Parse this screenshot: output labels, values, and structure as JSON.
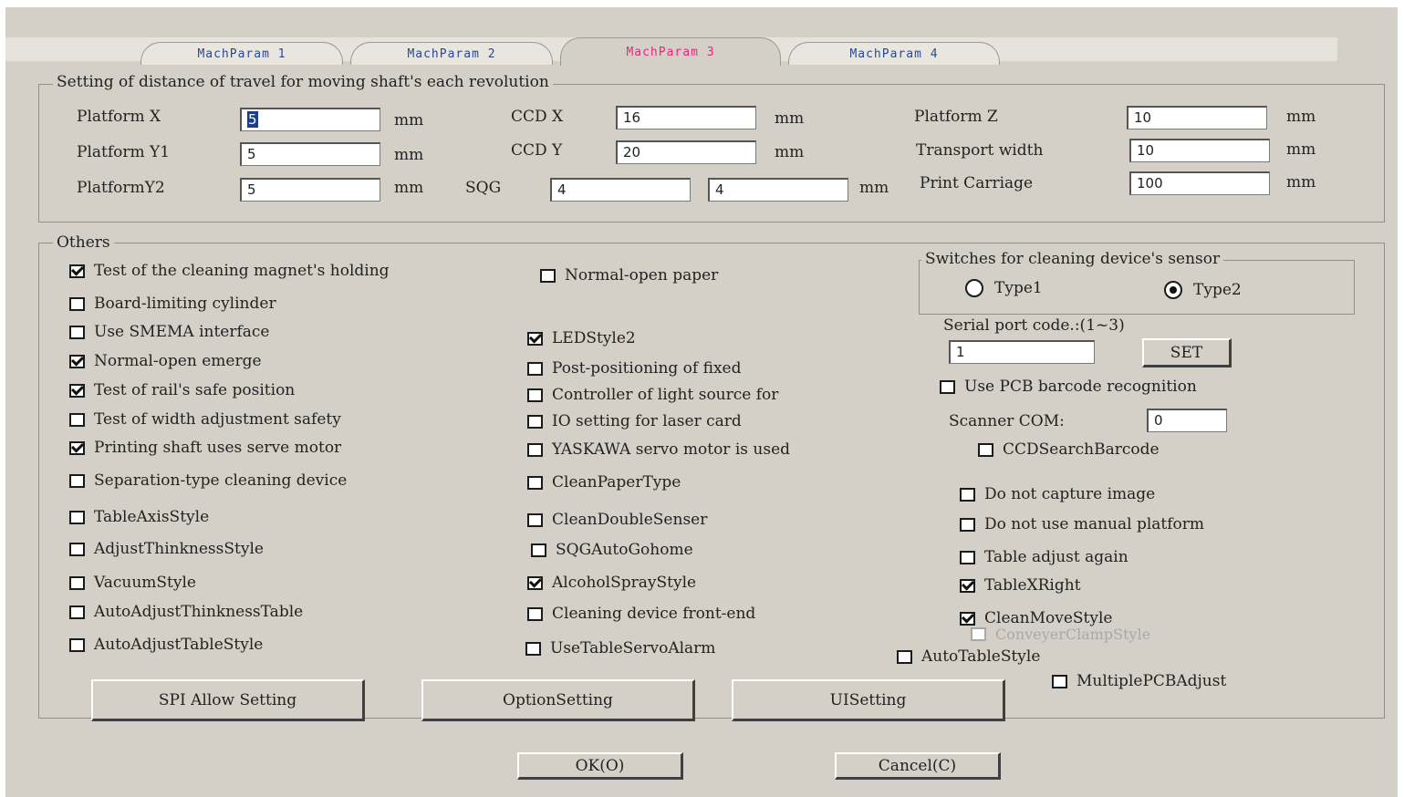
{
  "tabs": [
    "MachParam 1",
    "MachParam 2",
    "MachParam 3",
    "MachParam 4"
  ],
  "active_tab": 2,
  "travel": {
    "legend": "Setting of distance of travel for moving shaft's each revolution",
    "unit": "mm",
    "platform_x": {
      "label": "Platform X",
      "value": "5"
    },
    "platform_y1": {
      "label": "Platform Y1",
      "value": "5"
    },
    "platform_y2": {
      "label": "PlatformY2",
      "value": "5"
    },
    "ccd_x": {
      "label": "CCD X",
      "value": "16"
    },
    "ccd_y": {
      "label": "CCD Y",
      "value": "20"
    },
    "sqg": {
      "label": "SQG",
      "value1": "4",
      "value2": "4"
    },
    "platform_z": {
      "label": "Platform Z",
      "value": "10"
    },
    "transport_width": {
      "label": "Transport width",
      "value": "10"
    },
    "print_carriage": {
      "label": "Print Carriage",
      "value": "100"
    }
  },
  "others": {
    "legend": "Others",
    "col1": [
      {
        "label": "Test of the cleaning magnet's holding",
        "checked": true
      },
      {
        "label": "Board-limiting cylinder",
        "checked": false
      },
      {
        "label": "Use SMEMA interface",
        "checked": false
      },
      {
        "label": "Normal-open emerge",
        "checked": true
      },
      {
        "label": "Test of rail's safe position",
        "checked": true
      },
      {
        "label": "Test of width adjustment safety",
        "checked": false
      },
      {
        "label": "Printing shaft uses serve motor",
        "checked": true
      },
      {
        "label": "Separation-type cleaning device",
        "checked": false
      },
      {
        "label": "TableAxisStyle",
        "checked": false
      },
      {
        "label": "AdjustThinknessStyle",
        "checked": false
      },
      {
        "label": "VacuumStyle",
        "checked": false
      },
      {
        "label": "AutoAdjustThinknessTable",
        "checked": false
      },
      {
        "label": "AutoAdjustTableStyle",
        "checked": false
      }
    ],
    "col2": [
      {
        "label": "Normal-open paper",
        "checked": false
      },
      {
        "label": "LEDStyle2",
        "checked": true
      },
      {
        "label": "Post-positioning of fixed",
        "checked": false
      },
      {
        "label": "Controller of light source for",
        "checked": false
      },
      {
        "label": "IO setting for laser card",
        "checked": false
      },
      {
        "label": "YASKAWA servo motor is used",
        "checked": false
      },
      {
        "label": "CleanPaperType",
        "checked": false
      },
      {
        "label": "CleanDoubleSenser",
        "checked": false
      },
      {
        "label": "SQGAutoGohome",
        "checked": false
      },
      {
        "label": "AlcoholSprayStyle",
        "checked": true
      },
      {
        "label": "Cleaning device front-end",
        "checked": false
      },
      {
        "label": "UseTableServoAlarm",
        "checked": false
      }
    ],
    "sensor": {
      "legend": "Switches for cleaning device's sensor",
      "type1": {
        "label": "Type1",
        "selected": false
      },
      "type2": {
        "label": "Type2",
        "selected": true
      }
    },
    "serial": {
      "label": "Serial port code.:(1~3)",
      "value": "1",
      "set_label": "SET"
    },
    "use_pcb_barcode": {
      "label": "Use PCB barcode recognition",
      "checked": false
    },
    "scanner": {
      "label": "Scanner COM:",
      "value": "0"
    },
    "col3": [
      {
        "label": "CCDSearchBarcode",
        "checked": false
      },
      {
        "label": "Do not capture image",
        "checked": false
      },
      {
        "label": "Do not use manual platform",
        "checked": false
      },
      {
        "label": "Table adjust again",
        "checked": false
      },
      {
        "label": "TableXRight",
        "checked": true
      },
      {
        "label": "CleanMoveStyle",
        "checked": true
      }
    ],
    "conveyer_clamp": {
      "label": "ConveyerClampStyle",
      "checked": false
    },
    "auto_table": {
      "label": "AutoTableStyle",
      "checked": false
    },
    "multiple_pcb": {
      "label": "MultiplePCBAdjust",
      "checked": false
    }
  },
  "buttons": {
    "spi": "SPI Allow Setting",
    "option": "OptionSetting",
    "ui": "UISetting",
    "ok": "OK(O)",
    "cancel": "Cancel(C)"
  }
}
